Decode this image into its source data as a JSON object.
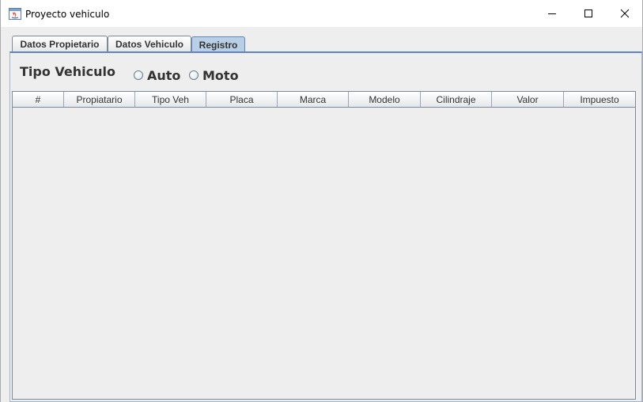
{
  "window": {
    "title": "Proyecto vehiculo",
    "controls": [
      "minimize",
      "maximize",
      "close"
    ]
  },
  "tabs": [
    {
      "label": "Datos Propietario",
      "selected": false
    },
    {
      "label": "Datos Vehiculo",
      "selected": false
    },
    {
      "label": "Registro",
      "selected": true
    }
  ],
  "registro": {
    "tipo_label": "Tipo Vehiculo",
    "options": [
      {
        "label": "Auto",
        "checked": false
      },
      {
        "label": "Moto",
        "checked": false
      }
    ],
    "table": {
      "columns": [
        "#",
        "Propiatario",
        "Tipo Veh",
        "Placa",
        "Marca",
        "Modelo",
        "Cilindraje",
        "Valor",
        "Impuesto"
      ],
      "rows": []
    }
  },
  "colors": {
    "selected_tab": "#b8cfe5",
    "panel_background": "#eeeeee",
    "border_accent": "#6382bf"
  }
}
